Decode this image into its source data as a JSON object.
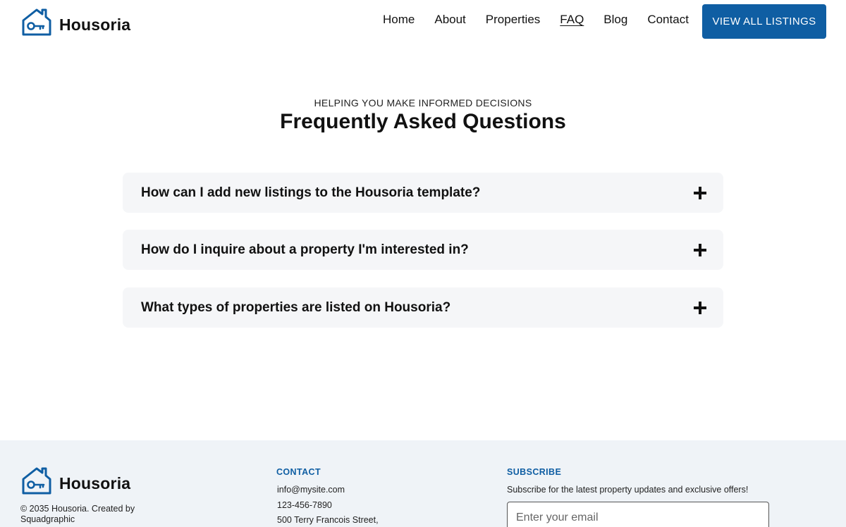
{
  "header": {
    "brand_name": "Housoria",
    "nav": [
      "Home",
      "About",
      "Properties",
      "FAQ",
      "Blog",
      "Contact"
    ],
    "active_nav": "FAQ",
    "cta_label": "VIEW ALL LISTINGS"
  },
  "hero": {
    "eyebrow": "HELPING YOU MAKE INFORMED DECISIONS",
    "title": "Frequently Asked Questions"
  },
  "faq": [
    {
      "question": "How can I add new listings to the Housoria template?",
      "icon": "plus-icon"
    },
    {
      "question": "How do I inquire about a property I'm interested in?",
      "icon": "plus-icon"
    },
    {
      "question": "What types of properties are listed on Housoria?",
      "icon": "plus-icon"
    }
  ],
  "footer": {
    "brand_name": "Housoria",
    "copyright": "© 2035 Housoria. Created by Squadgraphic",
    "contact_title": "CONTACT",
    "contact_lines": [
      "info@mysite.com",
      "123-456-7890",
      "500 Terry Francois Street,"
    ],
    "subscribe_title": "SUBSCRIBE",
    "subscribe_text": "Subscribe for the latest property updates and exclusive offers!",
    "email_placeholder": "Enter your email"
  },
  "colors": {
    "accent": "#0f5ea3",
    "card_bg": "#f5f6f8",
    "footer_bg": "#eff3f7"
  }
}
